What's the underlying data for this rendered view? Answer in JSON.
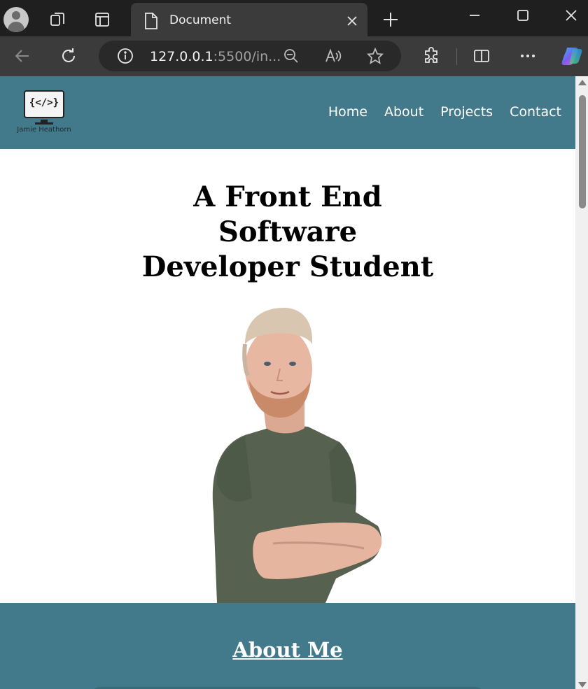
{
  "browser": {
    "tab_title": "Document",
    "address_host": "127.0.0.1",
    "address_rest": ":5500/in..."
  },
  "site": {
    "logo_code": "{</>}",
    "logo_name": "Jamie Heathorn",
    "nav": [
      "Home",
      "About",
      "Projects",
      "Contact"
    ],
    "hero_lines": [
      "A Front End",
      "Software",
      "Developer Student"
    ],
    "about_title": "About Me"
  },
  "colors": {
    "brand_teal": "#437a8b",
    "shirt_green": "#56624f"
  }
}
